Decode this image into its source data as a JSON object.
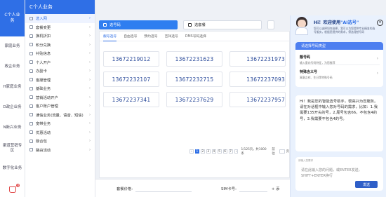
{
  "rail": {
    "top_label": "C个人业务",
    "items": [
      "家庭业务",
      "政企业务",
      "H家庭业务",
      "D政企业务",
      "N新兴业务",
      "渠道营销专区",
      "数字化业务"
    ],
    "cart_count": "0"
  },
  "menu": {
    "title": "C个人业务",
    "items": [
      {
        "label": "选入网",
        "active": true
      },
      {
        "label": "套餐变更"
      },
      {
        "label": "换机折扣"
      },
      {
        "label": "积分兑换"
      },
      {
        "label": "补贴信息"
      },
      {
        "label": "个人开户"
      },
      {
        "label": "办副卡"
      },
      {
        "label": "客服管理"
      },
      {
        "label": "基础业务"
      },
      {
        "label": "营销活动开户"
      },
      {
        "label": "客户账户管理"
      },
      {
        "label": "通信业务(流量、语音、短信)"
      },
      {
        "label": "宽带业务"
      },
      {
        "label": "优惠活动"
      },
      {
        "label": "融合包"
      },
      {
        "label": "路由活动"
      }
    ]
  },
  "toolbar": {
    "select_number_label": "选号码",
    "plan_label": "选套餐"
  },
  "tabs": [
    "靓号选号",
    "自由选号",
    "预约选号",
    "吉祥选号",
    "DMS号码选择"
  ],
  "numbers": [
    "13672219012",
    "13672231623",
    "13672231973",
    "13672232107",
    "13672232715",
    "13672237093",
    "13672237341",
    "13672237629",
    "13672237957"
  ],
  "pagination": {
    "pages": [
      "1",
      "2",
      "3",
      "4",
      "5",
      "6",
      "7"
    ],
    "active_index": 0,
    "summary": "1/125页，共1000条",
    "goto_label": "前往",
    "page_unit": "页"
  },
  "footer": {
    "plan_label": "套餐价格:",
    "sim_label": "SIM卡号:",
    "add_label": "+ 添"
  },
  "assistant": {
    "title_prefix": "Hi！欢迎使用",
    "title_name": "\"AI选号\"",
    "subtitle": "您可以选择如何选择，我可以为您提供专业精准的选号服务，根据您提供的需求，筛选理想号码",
    "type_title": "请选择号码类型",
    "options": [
      {
        "title": "靓号码",
        "desc": "输入意向号码特征，为您推荐"
      },
      {
        "title": "特殊含义号",
        "desc": "寓意吉祥、生日等特殊号码"
      }
    ],
    "message": "Hi！我是您的智能选号助手，很高兴为您服务。请在对话框中输入您对号码的需求，比如：1.我需要135开头的号，2.尾号包含66，不包含4的号，3.我需要不包含4的号。",
    "input_label": "请输入您需求",
    "input_placeholder": "请在此输入您的问题，或ENTER发送，SHIFT+ENTER换行",
    "send_label": "发送"
  }
}
